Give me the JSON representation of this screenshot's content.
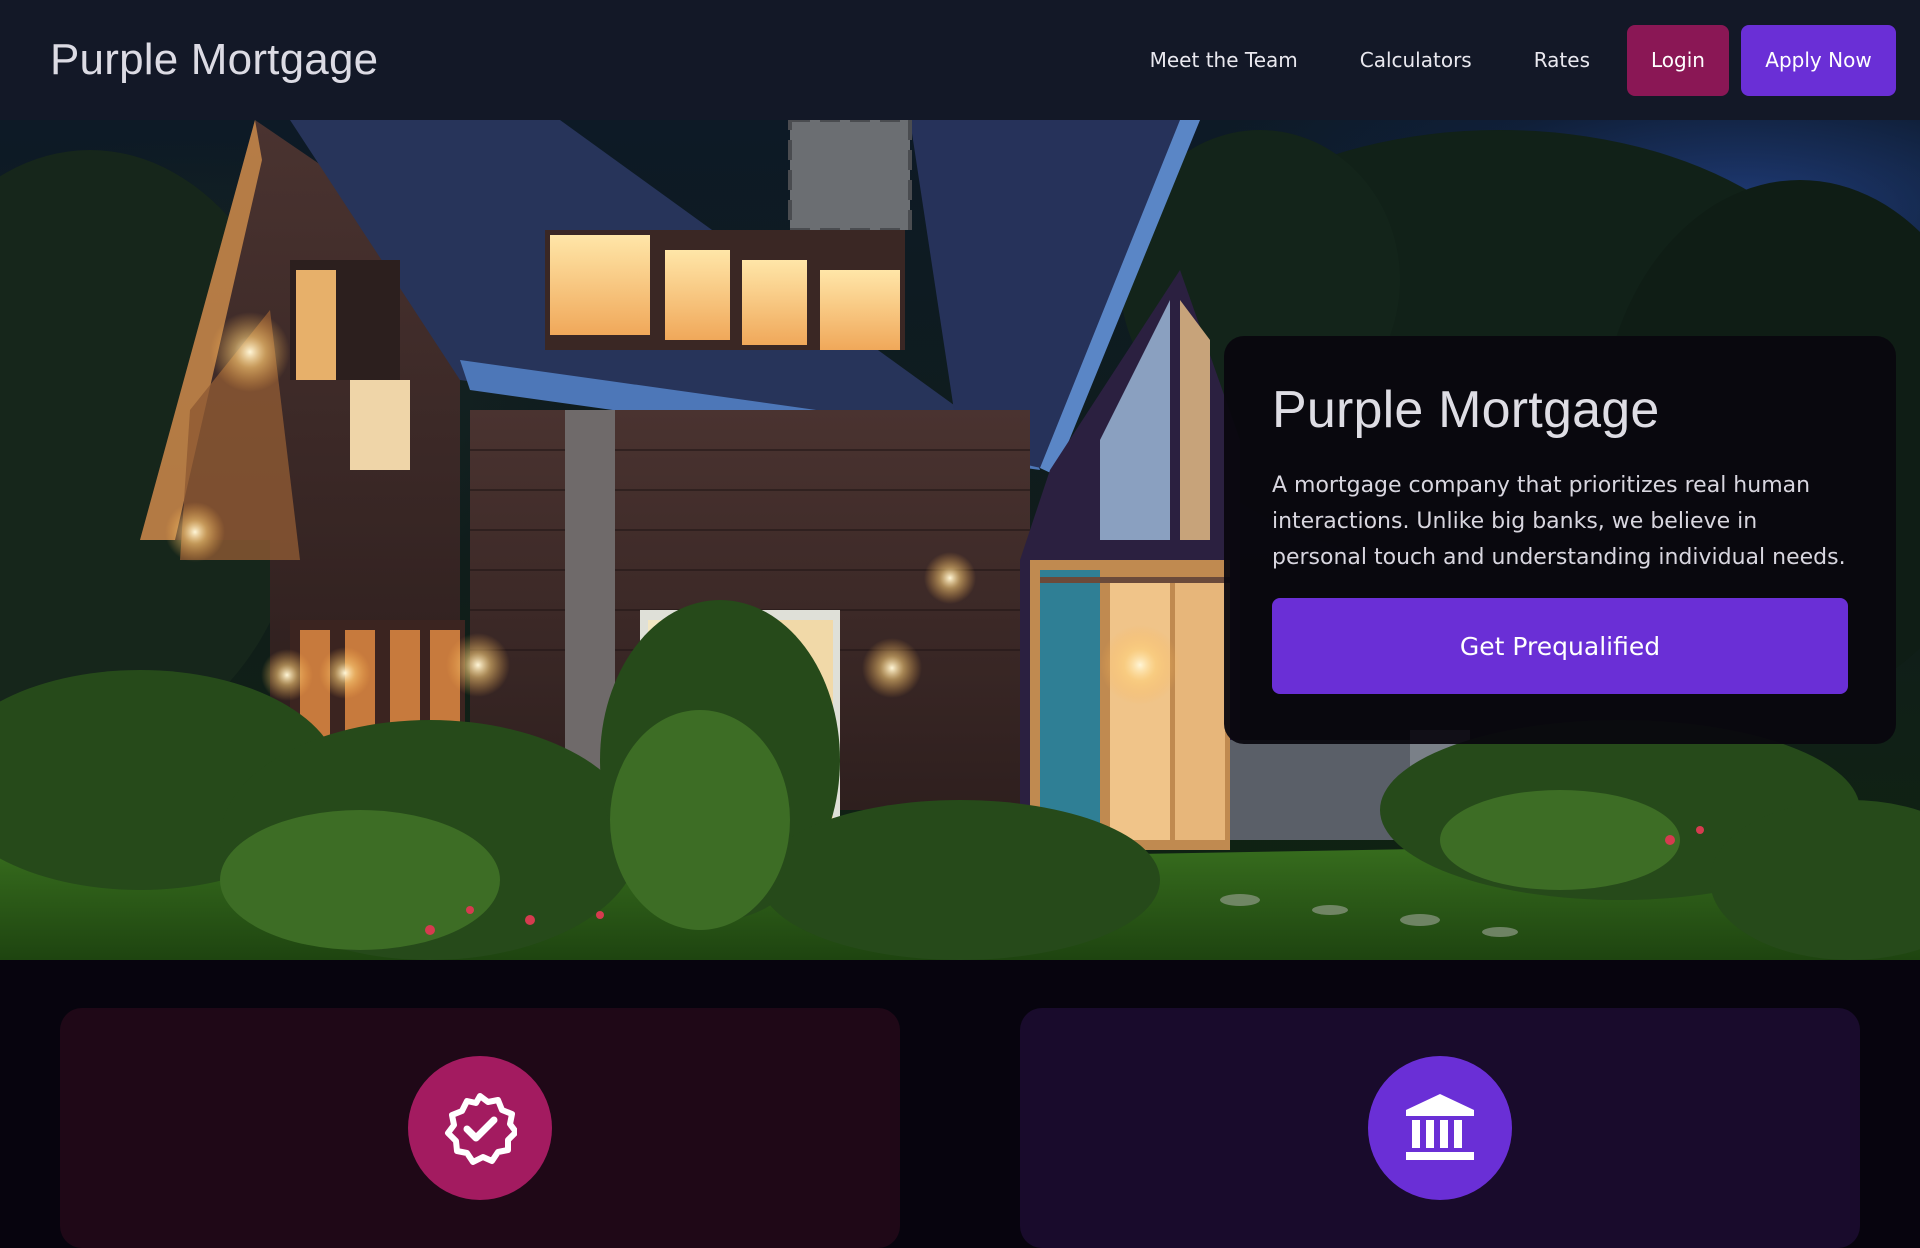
{
  "nav": {
    "brand": "Purple Mortgage",
    "links": [
      "Meet the Team",
      "Calculators",
      "Rates"
    ],
    "login_label": "Login",
    "apply_label": "Apply Now"
  },
  "hero": {
    "title": "Purple Mortgage",
    "description": "A mortgage company that prioritizes real human interactions. Unlike big banks, we believe in personal touch and understanding individual needs.",
    "cta_label": "Get Prequalified",
    "image": "house-at-dusk-photo"
  },
  "features": [
    {
      "icon": "badge-check-icon",
      "color": "#a31b60"
    },
    {
      "icon": "bank-icon",
      "color": "#6a2fd6"
    }
  ],
  "colors": {
    "nav_bg": "#131827",
    "page_bg": "#07040e",
    "login": "#8a1755",
    "primary": "#6a2fd6",
    "feature_1_bg": "#1f0817",
    "feature_2_bg": "#190b2c"
  }
}
